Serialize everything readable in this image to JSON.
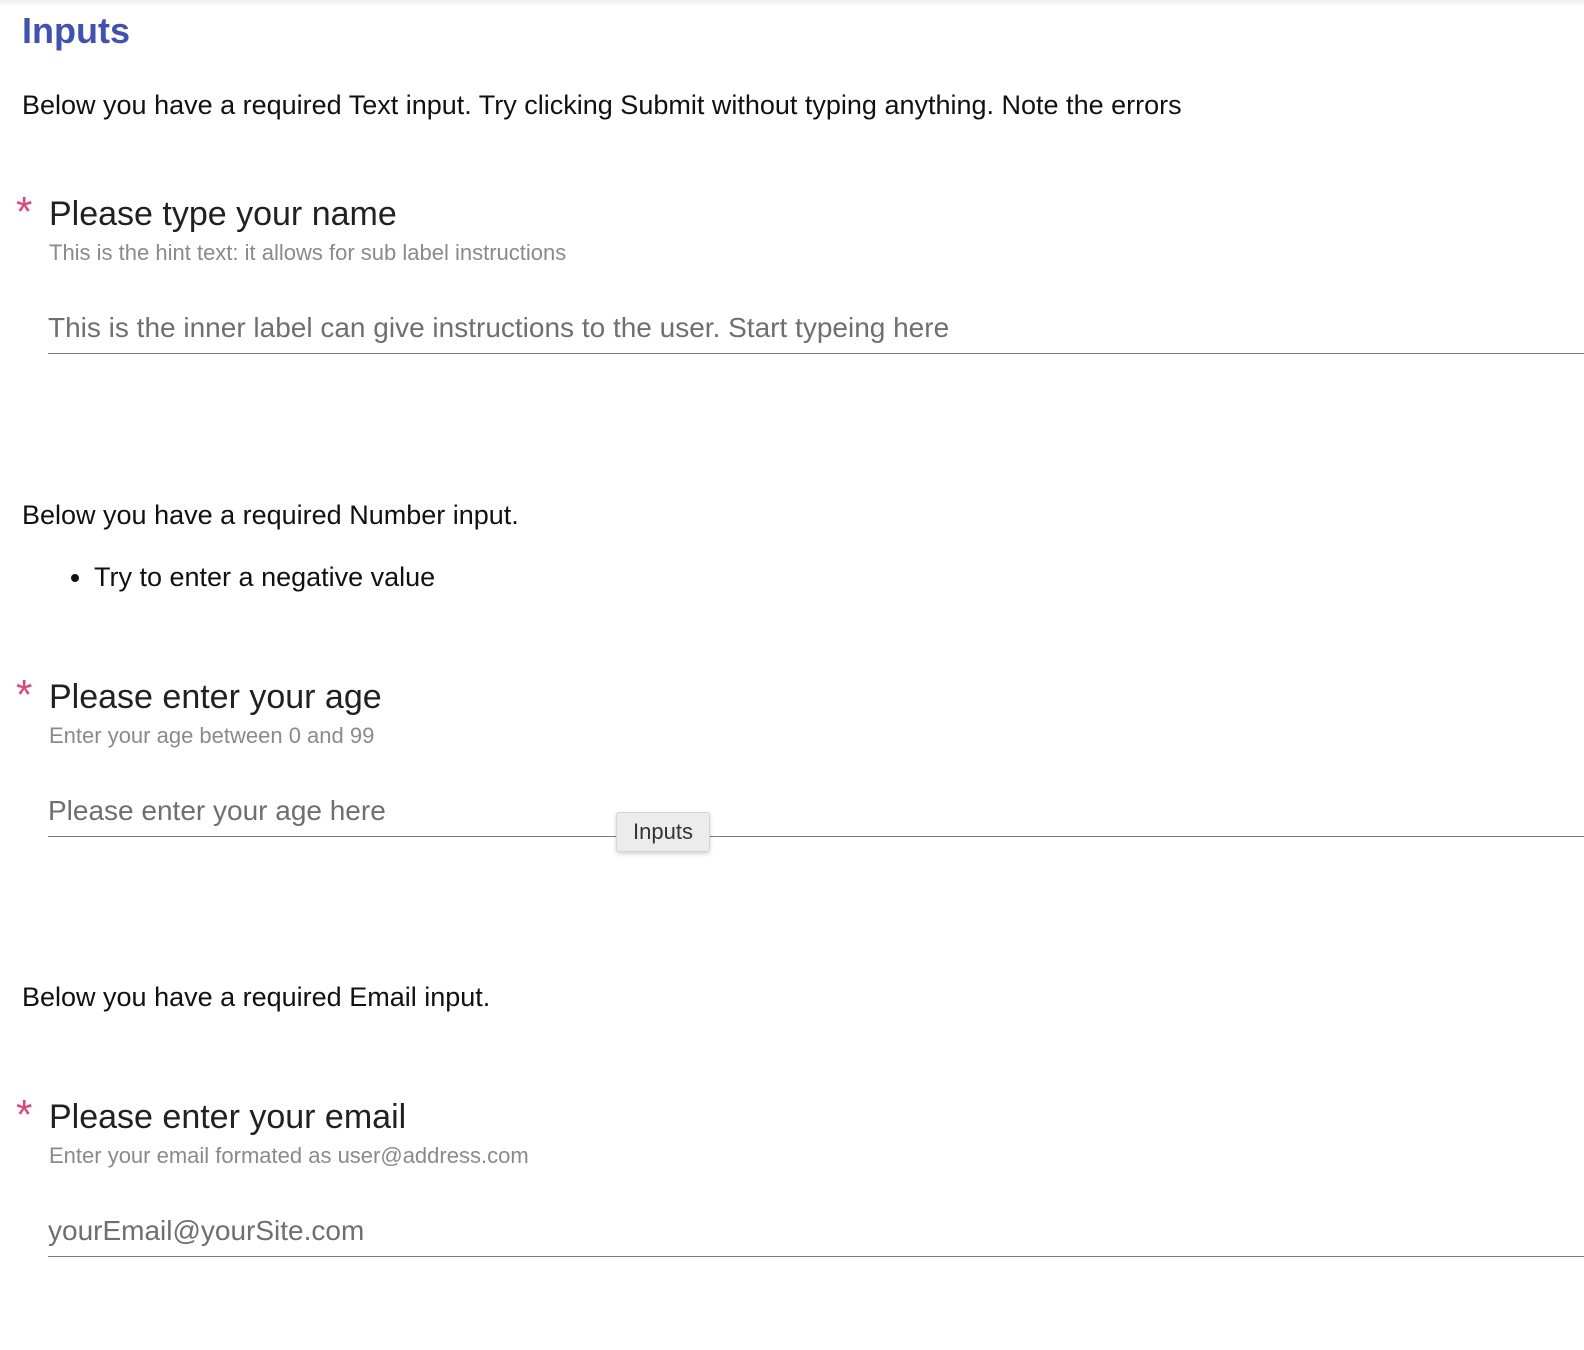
{
  "page": {
    "title": "Inputs"
  },
  "sections": {
    "text": {
      "intro": "Below you have a required Text input. Try clicking Submit without typing anything. Note the errors",
      "required_marker": "*",
      "label": "Please type your name",
      "hint": "This is the hint text: it allows for sub label instructions",
      "placeholder": "This is the inner label can give instructions to the user. Start typeing here",
      "value": ""
    },
    "number": {
      "intro": "Below you have a required Number input.",
      "bullets": [
        "Try to enter a negative value"
      ],
      "required_marker": "*",
      "label": "Please enter your age",
      "hint": "Enter your age between 0 and 99",
      "placeholder": "Please enter your age here",
      "value": ""
    },
    "email": {
      "intro": "Below you have a required Email input.",
      "required_marker": "*",
      "label": "Please enter your email",
      "hint": "Enter your email formated as user@address.com",
      "placeholder": "yourEmail@yourSite.com",
      "value": ""
    }
  },
  "tooltip": {
    "text": "Inputs"
  },
  "colors": {
    "title": "#3f51b5",
    "required": "#e0457b",
    "hint": "#8a8a8a",
    "underline": "#7a7a7a"
  }
}
